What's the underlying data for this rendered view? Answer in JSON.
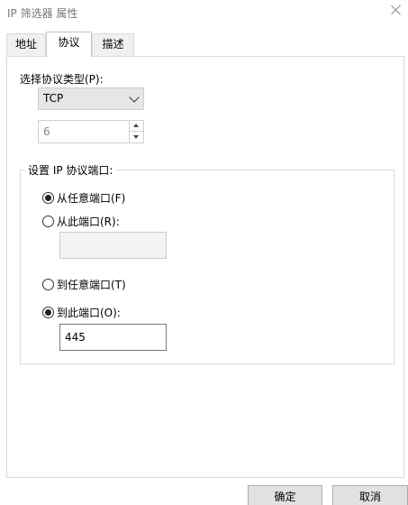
{
  "window": {
    "title": "IP 筛选器 属性"
  },
  "tabs": [
    {
      "label": "地址"
    },
    {
      "label": "协议"
    },
    {
      "label": "描述"
    }
  ],
  "protocol": {
    "type_label": "选择协议类型(P):",
    "type_value": "TCP",
    "number_value": "6"
  },
  "ports": {
    "group_label": "设置 IP 协议端口:",
    "from_any": "从任意端口(F)",
    "from_this": "从此端口(R):",
    "from_this_value": "",
    "to_any": "到任意端口(T)",
    "to_this": "到此端口(O):",
    "to_this_value": "445"
  },
  "selected": {
    "source": "from_any",
    "destination": "to_this"
  },
  "buttons": {
    "ok": "确定",
    "cancel": "取消"
  }
}
